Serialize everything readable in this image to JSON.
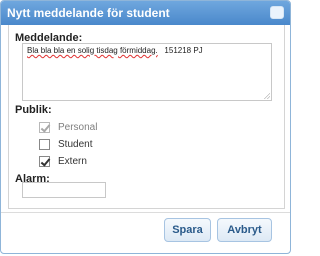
{
  "dialog": {
    "title": "Nytt meddelande för student"
  },
  "message": {
    "label": "Meddelande:",
    "text": "Bla bla bla en solig tisdag förmiddag.",
    "signature": "151218 PJ"
  },
  "publik": {
    "label": "Publik:",
    "options": [
      {
        "label": "Personal",
        "checked": true,
        "disabled": true
      },
      {
        "label": "Student",
        "checked": false,
        "disabled": false
      },
      {
        "label": "Extern",
        "checked": true,
        "disabled": false
      }
    ]
  },
  "alarm": {
    "label": "Alarm:",
    "value": ""
  },
  "buttons": {
    "save_label": "Spara",
    "cancel_label": "Avbryt"
  }
}
